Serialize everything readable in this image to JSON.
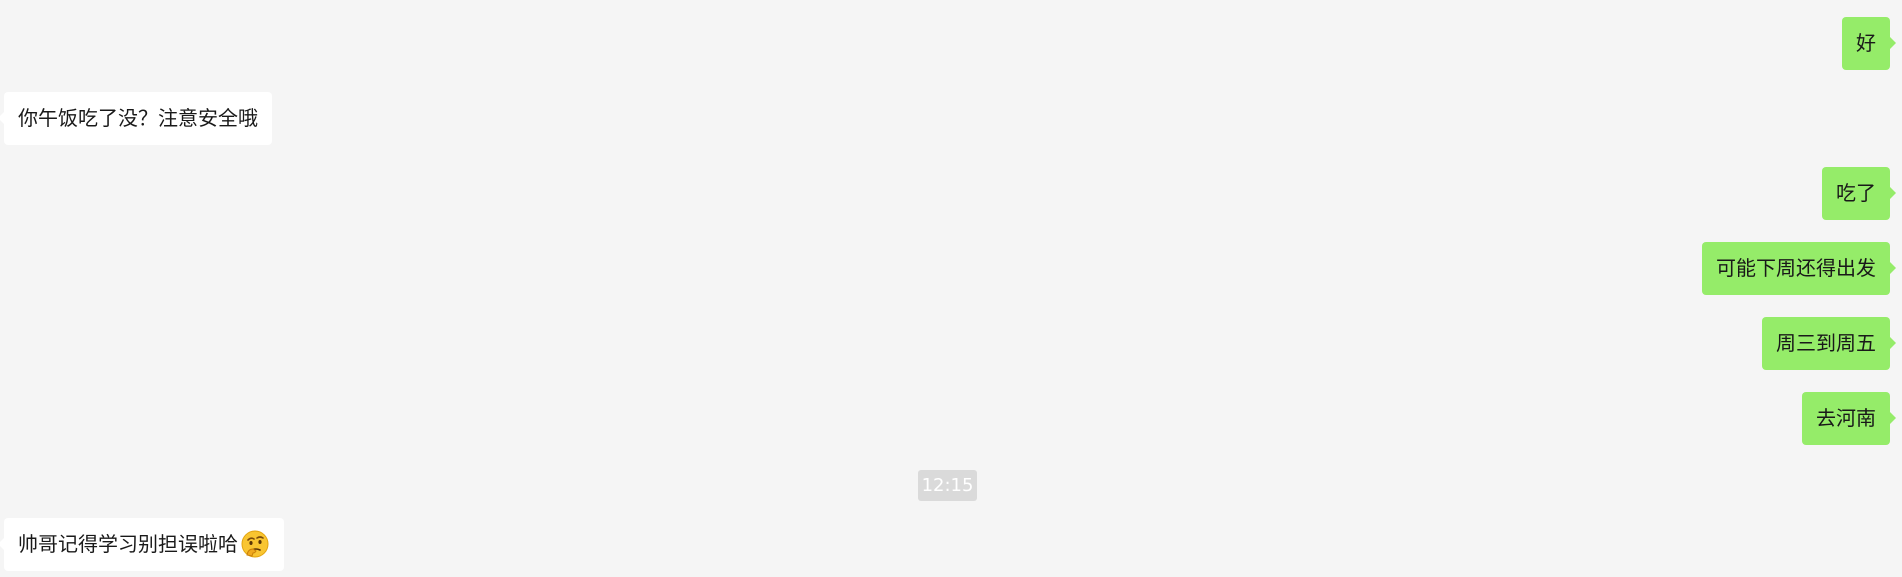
{
  "messages": [
    {
      "side": "out",
      "text": "好"
    },
    {
      "side": "in",
      "text": "你午饭吃了没？注意安全哦"
    },
    {
      "side": "out",
      "text": "吃了"
    },
    {
      "side": "out",
      "text": "可能下周还得出发"
    },
    {
      "side": "out",
      "text": "周三到周五"
    },
    {
      "side": "out",
      "text": "去河南"
    },
    {
      "side": "in",
      "text": "帅哥记得学习别担误啦哈",
      "emoji": "thinking-face-emoji"
    }
  ],
  "timestamp": "12:15",
  "colors": {
    "background": "#f5f5f5",
    "incoming_bubble": "#ffffff",
    "outgoing_bubble": "#95ec69",
    "timestamp_bg": "#dadada",
    "text": "#191919"
  }
}
